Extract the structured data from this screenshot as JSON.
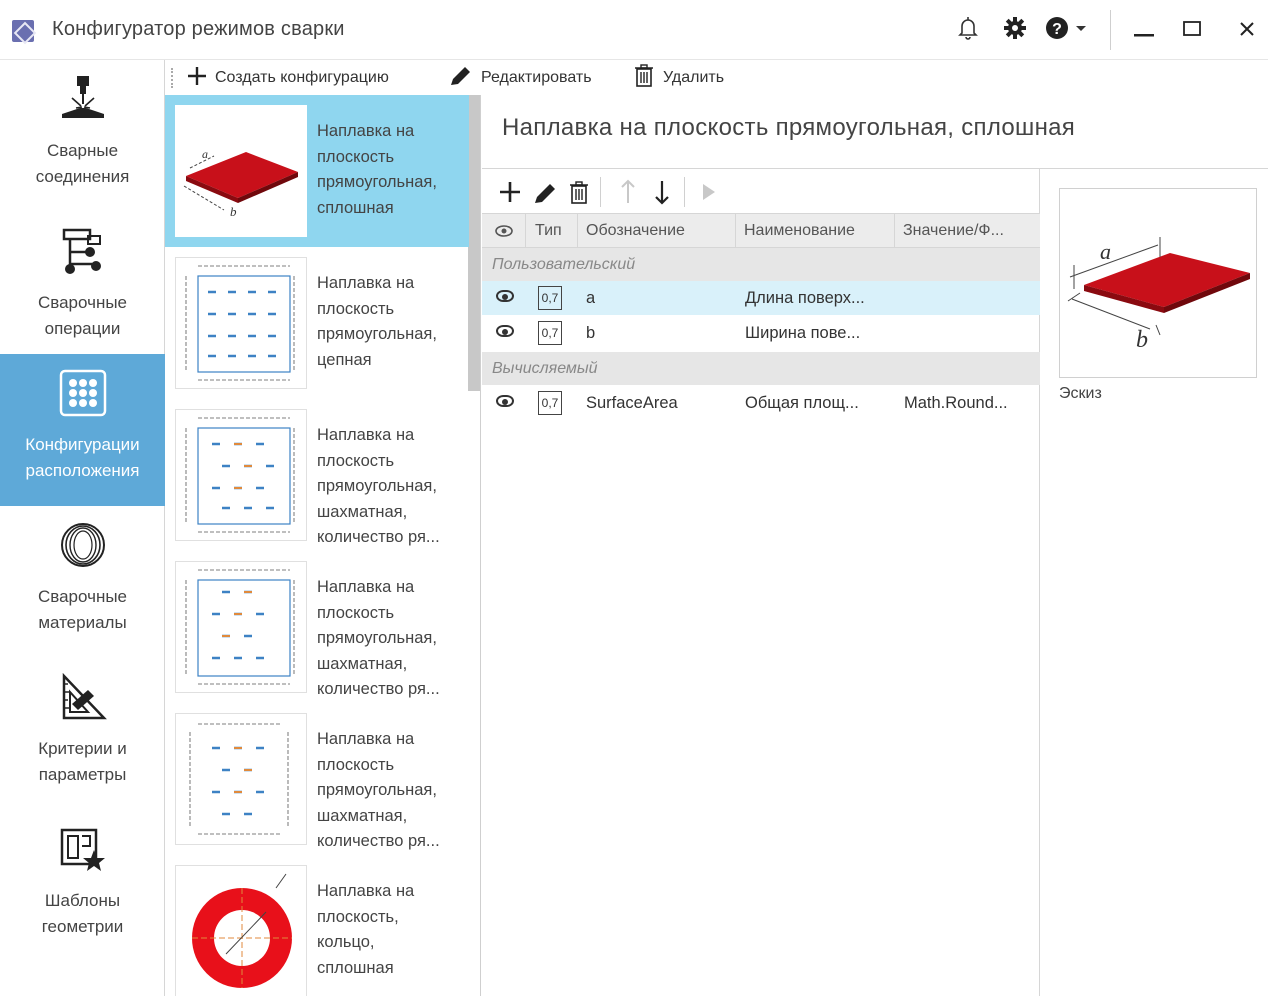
{
  "app": {
    "title": "Конфигуратор режимов сварки"
  },
  "window": {
    "icons": [
      "bell-icon",
      "gear-icon",
      "help-icon",
      "minimize-icon",
      "maximize-icon",
      "close-icon"
    ]
  },
  "toolbar": {
    "create_label": "Создать конфигурацию",
    "edit_label": "Редактировать",
    "delete_label": "Удалить"
  },
  "sidebar": {
    "items": [
      {
        "label": "Сварные\nсоединения",
        "icon": "weld-joint-icon",
        "active": false
      },
      {
        "label": "Сварочные\nоперации",
        "icon": "weld-operation-icon",
        "active": false
      },
      {
        "label": "Конфигурации\nрасположения",
        "icon": "grid-layout-icon",
        "active": true
      },
      {
        "label": "Сварочные\nматериалы",
        "icon": "wire-coil-icon",
        "active": false
      },
      {
        "label": "Критерии и\nпараметры",
        "icon": "triangle-ruler-icon",
        "active": false
      },
      {
        "label": "Шаблоны\nгеометрии",
        "icon": "geometry-template-icon",
        "active": false
      }
    ]
  },
  "configs": [
    {
      "text": "Наплавка на плоскость прямоугольная, сплошная",
      "lines": [
        "Наплавка на",
        "плоскость",
        "прямоугольная,",
        "сплошная"
      ],
      "selected": true
    },
    {
      "text": "Наплавка на плоскость прямоугольная, цепная",
      "lines": [
        "Наплавка на",
        "плоскость",
        "прямоугольная,",
        "цепная"
      ],
      "selected": false
    },
    {
      "text": "Наплавка на плоскость прямоугольная, шахматная, количество ря...",
      "lines": [
        "Наплавка на",
        "плоскость",
        "прямоугольная,",
        "шахматная,",
        "количество ря..."
      ],
      "selected": false
    },
    {
      "text": "Наплавка на плоскость прямоугольная, шахматная, количество ря...",
      "lines": [
        "Наплавка на",
        "плоскость",
        "прямоугольная,",
        "шахматная,",
        "количество ря..."
      ],
      "selected": false
    },
    {
      "text": "Наплавка на плоскость прямоугольная, шахматная, количество ря...",
      "lines": [
        "Наплавка на",
        "плоскость",
        "прямоугольная,",
        "шахматная,",
        "количество ря..."
      ],
      "selected": false
    },
    {
      "text": "Наплавка на плоскость, кольцо, сплошная",
      "lines": [
        "Наплавка на",
        "плоскость,",
        "кольцо,",
        "сплошная"
      ],
      "selected": false
    }
  ],
  "detail": {
    "title": "Наплавка на плоскость прямоугольная, сплошная",
    "grid_tools": [
      "add-icon",
      "edit-icon",
      "delete-icon",
      "move-up-icon",
      "move-down-icon",
      "run-icon"
    ],
    "columns": [
      "Тип",
      "Обозначение",
      "Наименование",
      "Значение/Ф..."
    ],
    "groups": [
      {
        "name": "Пользовательский",
        "rows": [
          {
            "type": "0,7",
            "symbol": "a",
            "name": "Длина поверх...",
            "value": "",
            "highlighted": true
          },
          {
            "type": "0,7",
            "symbol": "b",
            "name": "Ширина пове...",
            "value": "",
            "highlighted": false
          }
        ]
      },
      {
        "name": "Вычисляемый",
        "rows": [
          {
            "type": "0,7",
            "symbol": "SurfaceArea",
            "name": "Общая площ...",
            "value": "Math.Round...",
            "highlighted": false
          }
        ]
      }
    ]
  },
  "sketch": {
    "label": "Эскиз",
    "dims": [
      "a",
      "b"
    ]
  },
  "colors": {
    "accent": "#5ea9d8",
    "selected": "#8fd6ef",
    "row_highlight": "#d9f1fa",
    "plate": "#c8101a"
  }
}
